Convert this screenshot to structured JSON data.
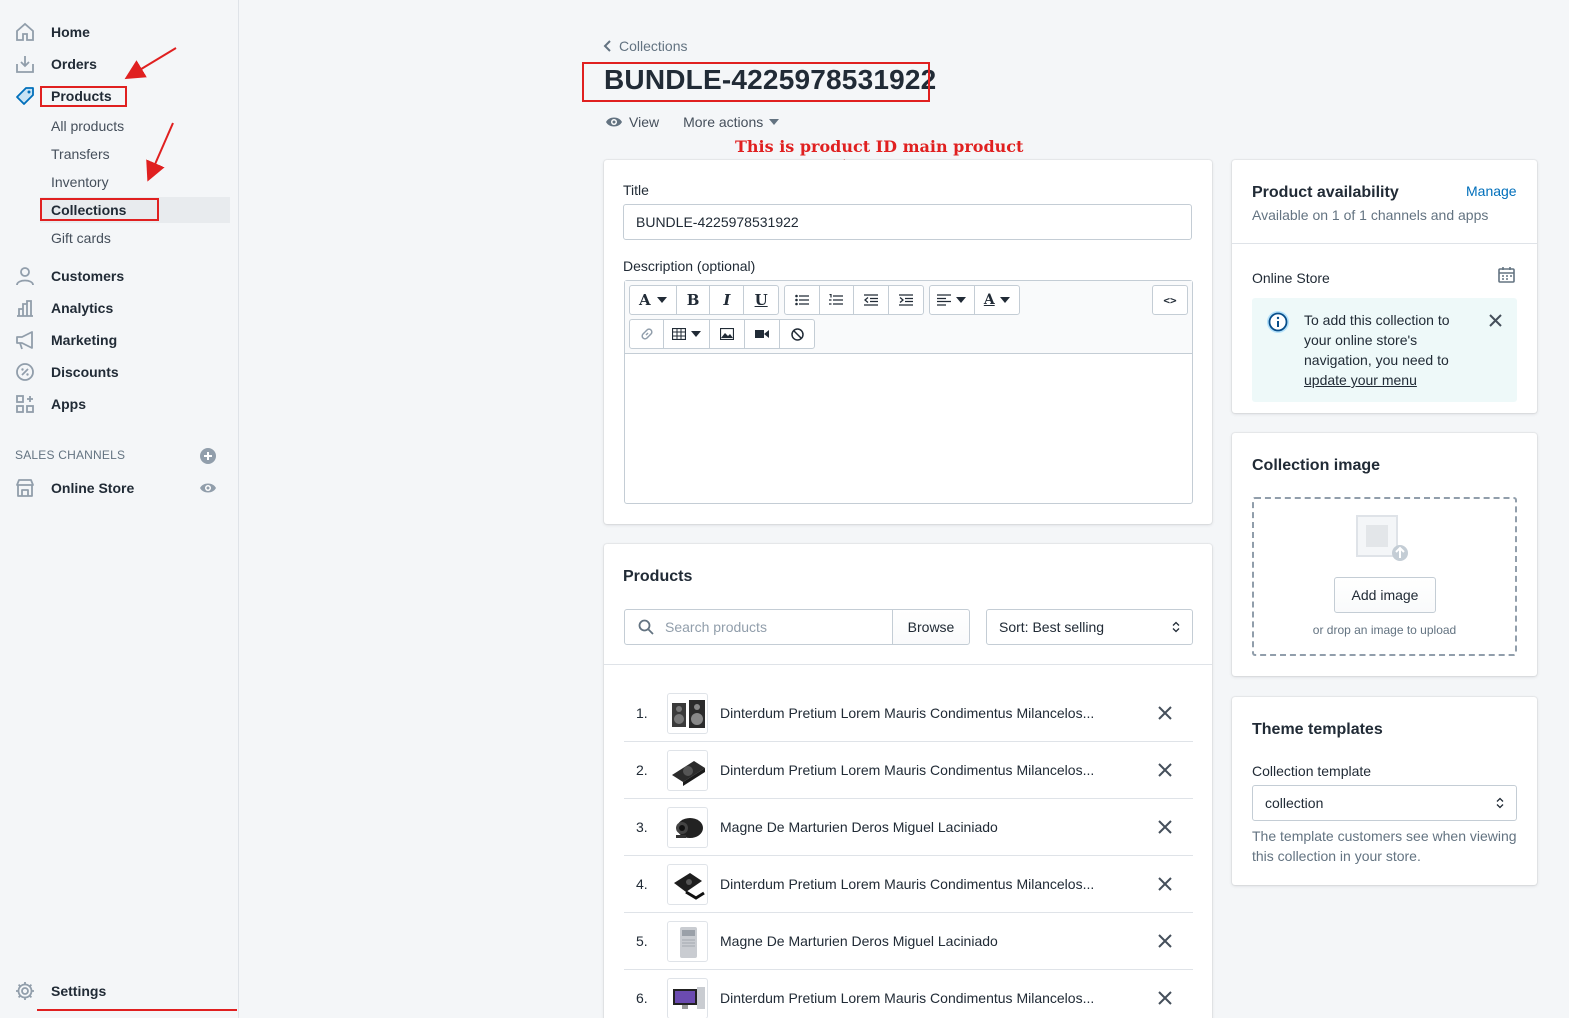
{
  "sidebar": {
    "nav": [
      {
        "label": "Home",
        "icon": "home-icon"
      },
      {
        "label": "Orders",
        "icon": "orders-icon"
      },
      {
        "label": "Products",
        "icon": "tag-icon"
      }
    ],
    "product_subitems": [
      "All products",
      "Transfers",
      "Inventory",
      "Collections",
      "Gift cards"
    ],
    "active_subitem": "Collections",
    "nav2": [
      {
        "label": "Customers",
        "icon": "customer-icon"
      },
      {
        "label": "Analytics",
        "icon": "analytics-icon"
      },
      {
        "label": "Marketing",
        "icon": "megaphone-icon"
      },
      {
        "label": "Discounts",
        "icon": "discount-icon"
      },
      {
        "label": "Apps",
        "icon": "apps-icon"
      }
    ],
    "sales_channels_heading": "SALES CHANNELS",
    "online_store": "Online Store",
    "settings": "Settings"
  },
  "header": {
    "breadcrumb": "Collections",
    "title": "BUNDLE-4225978531922",
    "view_label": "View",
    "more_actions_label": "More actions"
  },
  "annotation": "This is product ID main product",
  "details_card": {
    "title_label": "Title",
    "title_value": "BUNDLE-4225978531922",
    "description_label": "Description (optional)",
    "code_toggle": "<>"
  },
  "products_card": {
    "heading": "Products",
    "search_placeholder": "Search products",
    "browse_label": "Browse",
    "sort_value": "Sort: Best selling",
    "rows": [
      {
        "num": "1.",
        "name": "Dinterdum Pretium Lorem Mauris Condimentus Milancelos..."
      },
      {
        "num": "2.",
        "name": "Dinterdum Pretium Lorem Mauris Condimentus Milancelos..."
      },
      {
        "num": "3.",
        "name": "Magne De Marturien Deros Miguel Laciniado"
      },
      {
        "num": "4.",
        "name": "Dinterdum Pretium Lorem Mauris Condimentus Milancelos..."
      },
      {
        "num": "5.",
        "name": "Magne De Marturien Deros Miguel Laciniado"
      },
      {
        "num": "6.",
        "name": "Dinterdum Pretium Lorem Mauris Condimentus Milancelos..."
      }
    ]
  },
  "availability_card": {
    "heading": "Product availability",
    "manage_label": "Manage",
    "subtext": "Available on 1 of 1 channels and apps",
    "channel": "Online Store",
    "banner_text": "To add this collection to your online store's navigation, you need to ",
    "banner_link": "update your menu"
  },
  "image_card": {
    "heading": "Collection image",
    "add_image_label": "Add image",
    "drop_hint": "or drop an image to upload"
  },
  "theme_card": {
    "heading": "Theme templates",
    "template_label": "Collection template",
    "template_value": "collection",
    "help_text": "The template customers see when viewing this collection in your store."
  },
  "colors": {
    "annotation_red": "#e02020",
    "link_blue": "#006fbb",
    "banner_teal": "#eef9f9"
  }
}
